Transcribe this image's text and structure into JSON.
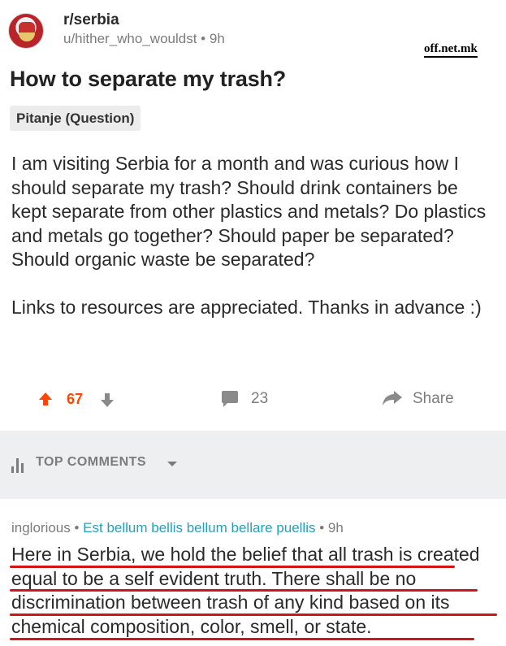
{
  "post": {
    "subreddit": "r/serbia",
    "author": "u/hither_who_wouldst",
    "age": "9h",
    "title": "How to separate my trash?",
    "flair": "Pitanje (Question)",
    "body": [
      "I am visiting Serbia for a month and was curious how I should separate my trash? Should drink containers be kept separate from other plastics and metals? Do plastics and metals go together? Should paper be separated? Should organic waste be separated?",
      "Links to resources are appreciated. Thanks in advance :)"
    ],
    "actions": {
      "score": "67",
      "comments": "23",
      "share": "Share"
    }
  },
  "watermark": "off.net.mk",
  "comments_section": {
    "sort_label": "TOP COMMENTS"
  },
  "top_comment": {
    "author": "inglorious",
    "user_flair": "Est bellum bellis bellum bellare puellis",
    "age": "9h",
    "text": "Here in Serbia, we hold the belief that all trash is created equal to be a self evident truth. There shall be no discrimination between trash of any kind based on its chemical composition, color, smell, or state."
  },
  "colors": {
    "upvote": "#ff4500",
    "muted": "#7c7c7c",
    "band": "#edeff1",
    "underline": "#d11414",
    "flair_link": "#24a0c0"
  },
  "icons": [
    "subreddit-avatar",
    "upvote-icon",
    "downvote-icon",
    "comment-icon",
    "share-icon",
    "sort-icon",
    "chevron-down-icon"
  ]
}
